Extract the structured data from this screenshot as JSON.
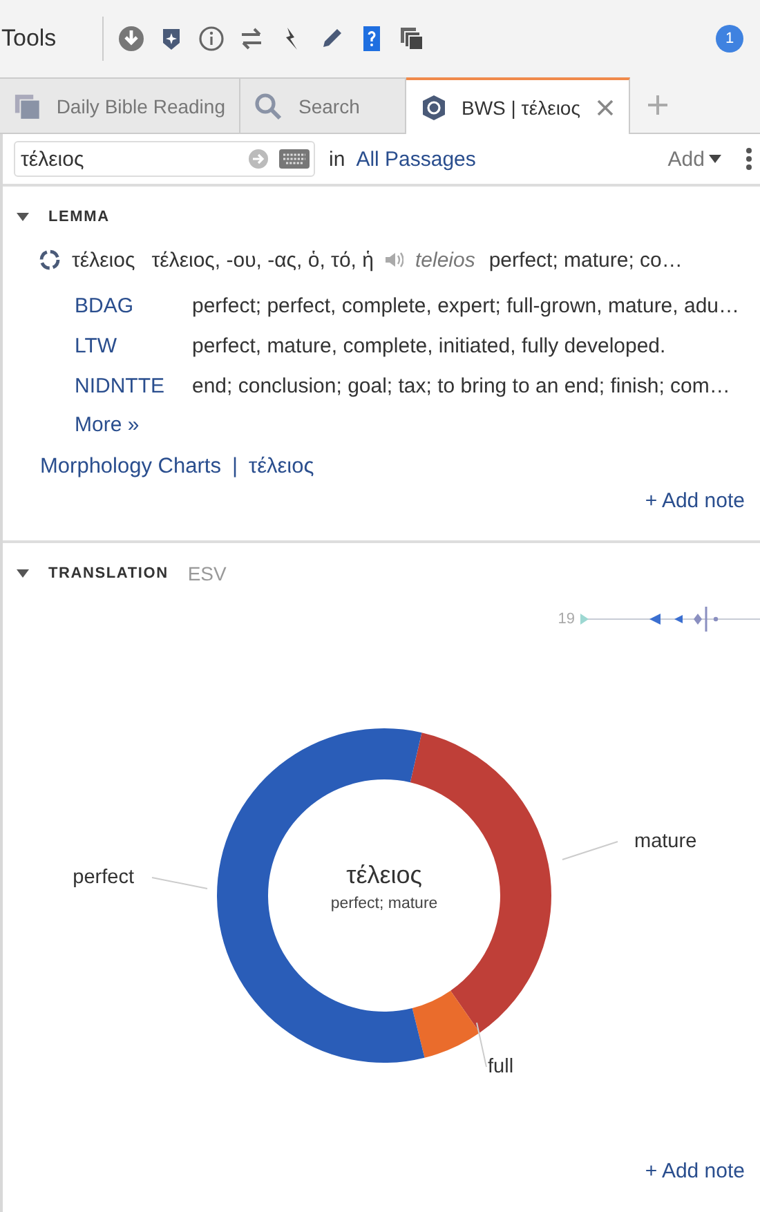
{
  "toolbar": {
    "title": "Tools",
    "badge": "1"
  },
  "tabs": [
    {
      "label": "Daily Bible Reading",
      "kind": "stack",
      "selected": false,
      "closable": false
    },
    {
      "label": "Search",
      "kind": "search",
      "selected": false,
      "closable": false
    },
    {
      "label": "BWS | τέλειος",
      "kind": "bws",
      "selected": true,
      "closable": true
    }
  ],
  "search": {
    "value": "τέλειος",
    "in_label": "in",
    "scope": "All Passages",
    "add": "Add"
  },
  "lemma": {
    "heading": "LEMMA",
    "expanded": true,
    "word": "τέλειος",
    "forms": "τέλειος, -ου, -ας, ὁ, τό, ἡ",
    "translit": "teleios",
    "gloss": "perfect; mature; co…",
    "sources": [
      {
        "name": "BDAG",
        "text": "perfect; perfect, complete, expert; full-grown, mature, adu…"
      },
      {
        "name": "LTW",
        "text": "perfect, mature, complete, initiated, fully developed."
      },
      {
        "name": "NIDNTTE",
        "text": "end; conclusion; goal; tax; to bring to an end; finish; com…"
      }
    ],
    "more": "More »",
    "morph_link": "Morphology Charts",
    "morph_sep": "|",
    "morph_word": "τέλειος",
    "add_note": "+ Add note"
  },
  "translation": {
    "heading": "TRANSLATION",
    "expanded": true,
    "version": "ESV",
    "spark_label": "19",
    "donut": {
      "title": "τέλειος",
      "subtitle": "perfect; mature",
      "slices": [
        {
          "label": "mature",
          "color": "#bf3f38"
        },
        {
          "label": "full",
          "color": "#ea6c2c"
        },
        {
          "label": "perfect",
          "color": "#2a5db8"
        }
      ]
    },
    "add_note": "+ Add note"
  }
}
